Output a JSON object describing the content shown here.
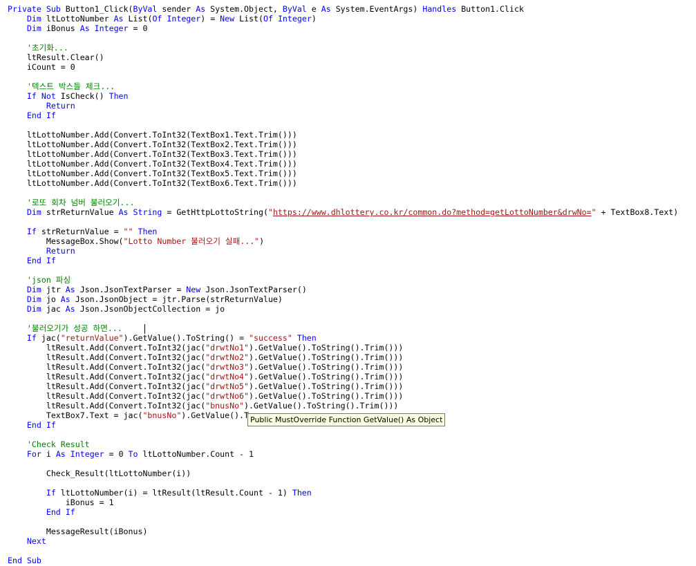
{
  "colors": {
    "keyword": "#0000ff",
    "string": "#a31515",
    "comment": "#008000",
    "text": "#000000",
    "background": "#ffffff",
    "tooltip_background": "#ffffe1"
  },
  "code_lines": [
    [
      [
        "kw",
        "Private Sub"
      ],
      [
        "plain",
        " Button1_Click("
      ],
      [
        "kw",
        "ByVal"
      ],
      [
        "plain",
        " sender "
      ],
      [
        "kw",
        "As"
      ],
      [
        "plain",
        " System.Object, "
      ],
      [
        "kw",
        "ByVal"
      ],
      [
        "plain",
        " e "
      ],
      [
        "kw",
        "As"
      ],
      [
        "plain",
        " System.EventArgs) "
      ],
      [
        "kw",
        "Handles"
      ],
      [
        "plain",
        " Button1.Click"
      ]
    ],
    [
      [
        "plain",
        "    "
      ],
      [
        "kw",
        "Dim"
      ],
      [
        "plain",
        " ltLottoNumber "
      ],
      [
        "kw",
        "As"
      ],
      [
        "plain",
        " List("
      ],
      [
        "kw",
        "Of Integer"
      ],
      [
        "plain",
        ") = "
      ],
      [
        "kw",
        "New"
      ],
      [
        "plain",
        " List("
      ],
      [
        "kw",
        "Of Integer"
      ],
      [
        "plain",
        ")"
      ]
    ],
    [
      [
        "plain",
        "    "
      ],
      [
        "kw",
        "Dim"
      ],
      [
        "plain",
        " iBonus "
      ],
      [
        "kw",
        "As Integer"
      ],
      [
        "plain",
        " = 0"
      ]
    ],
    [],
    [
      [
        "plain",
        "    "
      ],
      [
        "cmt",
        "'초기화..."
      ]
    ],
    [
      [
        "plain",
        "    ltResult.Clear()"
      ]
    ],
    [
      [
        "plain",
        "    iCount = 0"
      ]
    ],
    [],
    [
      [
        "plain",
        "    "
      ],
      [
        "cmt",
        "'텍스트 박스들 체크..."
      ]
    ],
    [
      [
        "plain",
        "    "
      ],
      [
        "kw",
        "If Not"
      ],
      [
        "plain",
        " IsCheck() "
      ],
      [
        "kw",
        "Then"
      ]
    ],
    [
      [
        "plain",
        "        "
      ],
      [
        "kw",
        "Return"
      ]
    ],
    [
      [
        "plain",
        "    "
      ],
      [
        "kw",
        "End If"
      ]
    ],
    [],
    [
      [
        "plain",
        "    ltLottoNumber.Add(Convert.ToInt32(TextBox1.Text.Trim()))"
      ]
    ],
    [
      [
        "plain",
        "    ltLottoNumber.Add(Convert.ToInt32(TextBox2.Text.Trim()))"
      ]
    ],
    [
      [
        "plain",
        "    ltLottoNumber.Add(Convert.ToInt32(TextBox3.Text.Trim()))"
      ]
    ],
    [
      [
        "plain",
        "    ltLottoNumber.Add(Convert.ToInt32(TextBox4.Text.Trim()))"
      ]
    ],
    [
      [
        "plain",
        "    ltLottoNumber.Add(Convert.ToInt32(TextBox5.Text.Trim()))"
      ]
    ],
    [
      [
        "plain",
        "    ltLottoNumber.Add(Convert.ToInt32(TextBox6.Text.Trim()))"
      ]
    ],
    [],
    [
      [
        "plain",
        "    "
      ],
      [
        "cmt",
        "'로또 회차 넘버 불러오기..."
      ]
    ],
    [
      [
        "plain",
        "    "
      ],
      [
        "kw",
        "Dim"
      ],
      [
        "plain",
        " strReturnValue "
      ],
      [
        "kw",
        "As String"
      ],
      [
        "plain",
        " = GetHttpLottoString("
      ],
      [
        "str",
        "\""
      ],
      [
        "url",
        "https://www.dhlottery.co.kr/common.do?method=getLottoNumber&drwNo="
      ],
      [
        "str",
        "\""
      ],
      [
        "plain",
        " + TextBox8.Text)"
      ]
    ],
    [],
    [
      [
        "plain",
        "    "
      ],
      [
        "kw",
        "If"
      ],
      [
        "plain",
        " strReturnValue = "
      ],
      [
        "str",
        "\"\""
      ],
      [
        "plain",
        " "
      ],
      [
        "kw",
        "Then"
      ]
    ],
    [
      [
        "plain",
        "        MessageBox.Show("
      ],
      [
        "str",
        "\"Lotto Number 불러오기 실패...\""
      ],
      [
        "plain",
        ")"
      ]
    ],
    [
      [
        "plain",
        "        "
      ],
      [
        "kw",
        "Return"
      ]
    ],
    [
      [
        "plain",
        "    "
      ],
      [
        "kw",
        "End If"
      ]
    ],
    [],
    [
      [
        "plain",
        "    "
      ],
      [
        "cmt",
        "'json 파싱"
      ]
    ],
    [
      [
        "plain",
        "    "
      ],
      [
        "kw",
        "Dim"
      ],
      [
        "plain",
        " jtr "
      ],
      [
        "kw",
        "As"
      ],
      [
        "plain",
        " Json.JsonTextParser = "
      ],
      [
        "kw",
        "New"
      ],
      [
        "plain",
        " Json.JsonTextParser()"
      ]
    ],
    [
      [
        "plain",
        "    "
      ],
      [
        "kw",
        "Dim"
      ],
      [
        "plain",
        " jo "
      ],
      [
        "kw",
        "As"
      ],
      [
        "plain",
        " Json.JsonObject = jtr.Parse(strReturnValue)"
      ]
    ],
    [
      [
        "plain",
        "    "
      ],
      [
        "kw",
        "Dim"
      ],
      [
        "plain",
        " jac "
      ],
      [
        "kw",
        "As"
      ],
      [
        "plain",
        " Json.JsonObjectCollection = jo"
      ]
    ],
    [],
    [
      [
        "plain",
        "    "
      ],
      [
        "cmt",
        "'불러오기가 성공 하면..."
      ]
    ],
    [
      [
        "plain",
        "    "
      ],
      [
        "kw",
        "If"
      ],
      [
        "plain",
        " jac("
      ],
      [
        "str",
        "\"returnValue\""
      ],
      [
        "plain",
        ").GetValue().ToString() = "
      ],
      [
        "str",
        "\"success\""
      ],
      [
        "plain",
        " "
      ],
      [
        "kw",
        "Then"
      ]
    ],
    [
      [
        "plain",
        "        ltResult.Add(Convert.ToInt32(jac("
      ],
      [
        "str",
        "\"drwtNo1\""
      ],
      [
        "plain",
        ").GetValue().ToString().Trim()))"
      ]
    ],
    [
      [
        "plain",
        "        ltResult.Add(Convert.ToInt32(jac("
      ],
      [
        "str",
        "\"drwtNo2\""
      ],
      [
        "plain",
        ").GetValue().ToString().Trim()))"
      ]
    ],
    [
      [
        "plain",
        "        ltResult.Add(Convert.ToInt32(jac("
      ],
      [
        "str",
        "\"drwtNo3\""
      ],
      [
        "plain",
        ").GetValue().ToString().Trim()))"
      ]
    ],
    [
      [
        "plain",
        "        ltResult.Add(Convert.ToInt32(jac("
      ],
      [
        "str",
        "\"drwtNo4\""
      ],
      [
        "plain",
        ").GetValue().ToString().Trim()))"
      ]
    ],
    [
      [
        "plain",
        "        ltResult.Add(Convert.ToInt32(jac("
      ],
      [
        "str",
        "\"drwtNo5\""
      ],
      [
        "plain",
        ").GetValue().ToString().Trim()))"
      ]
    ],
    [
      [
        "plain",
        "        ltResult.Add(Convert.ToInt32(jac("
      ],
      [
        "str",
        "\"drwtNo6\""
      ],
      [
        "plain",
        ").GetValue().ToString().Trim()))"
      ]
    ],
    [
      [
        "plain",
        "        ltResult.Add(Convert.ToInt32(jac("
      ],
      [
        "str",
        "\"bnusNo\""
      ],
      [
        "plain",
        ").GetValue().ToString().Trim()))"
      ]
    ],
    [
      [
        "plain",
        "        TextBox7.Text = jac("
      ],
      [
        "str",
        "\"bnusNo\""
      ],
      [
        "plain",
        ").GetValue().T"
      ]
    ],
    [
      [
        "plain",
        "    "
      ],
      [
        "kw",
        "End If"
      ]
    ],
    [],
    [
      [
        "plain",
        "    "
      ],
      [
        "cmt",
        "'Check Result"
      ]
    ],
    [
      [
        "plain",
        "    "
      ],
      [
        "kw",
        "For"
      ],
      [
        "plain",
        " i "
      ],
      [
        "kw",
        "As Integer"
      ],
      [
        "plain",
        " = 0 "
      ],
      [
        "kw",
        "To"
      ],
      [
        "plain",
        " ltLottoNumber.Count - 1"
      ]
    ],
    [],
    [
      [
        "plain",
        "        Check_Result(ltLottoNumber(i))"
      ]
    ],
    [],
    [
      [
        "plain",
        "        "
      ],
      [
        "kw",
        "If"
      ],
      [
        "plain",
        " ltLottoNumber(i) = ltResult(ltResult.Count - 1) "
      ],
      [
        "kw",
        "Then"
      ]
    ],
    [
      [
        "plain",
        "            iBonus = 1"
      ]
    ],
    [
      [
        "plain",
        "        "
      ],
      [
        "kw",
        "End If"
      ]
    ],
    [],
    [
      [
        "plain",
        "        MessageResult(iBonus)"
      ]
    ],
    [
      [
        "plain",
        "    "
      ],
      [
        "kw",
        "Next"
      ]
    ],
    [],
    [
      [
        "kw",
        "End Sub"
      ]
    ]
  ],
  "tooltip": {
    "text": "Public MustOverride Function GetValue() As Object"
  }
}
